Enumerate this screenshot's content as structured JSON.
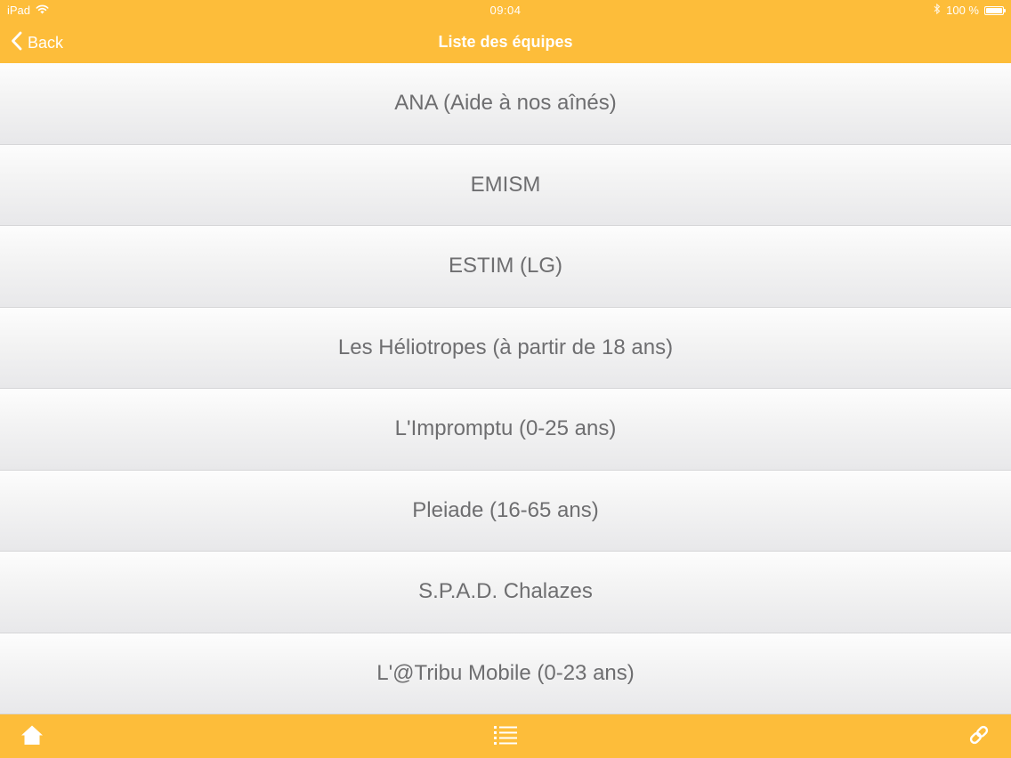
{
  "status_bar": {
    "device": "iPad",
    "time": "09:04",
    "battery_text": "100 %",
    "battery_level": 1.0
  },
  "nav_bar": {
    "back_label": "Back",
    "title": "Liste des équipes"
  },
  "teams": [
    {
      "label": "ANA (Aide à nos aînés)"
    },
    {
      "label": "EMISM"
    },
    {
      "label": "ESTIM (LG)"
    },
    {
      "label": "Les Héliotropes (à partir de 18 ans)"
    },
    {
      "label": "L'Impromptu (0-25 ans)"
    },
    {
      "label": "Pleiade (16-65 ans)"
    },
    {
      "label": "S.P.A.D. Chalazes"
    },
    {
      "label": "L'@Tribu Mobile (0-23 ans)"
    }
  ],
  "tab_bar": {
    "icons": [
      "home-icon",
      "list-icon",
      "link-icon"
    ]
  },
  "colors": {
    "accent": "#fdbd3a",
    "item_text": "#6e6e70",
    "icon": "#ffffff"
  }
}
